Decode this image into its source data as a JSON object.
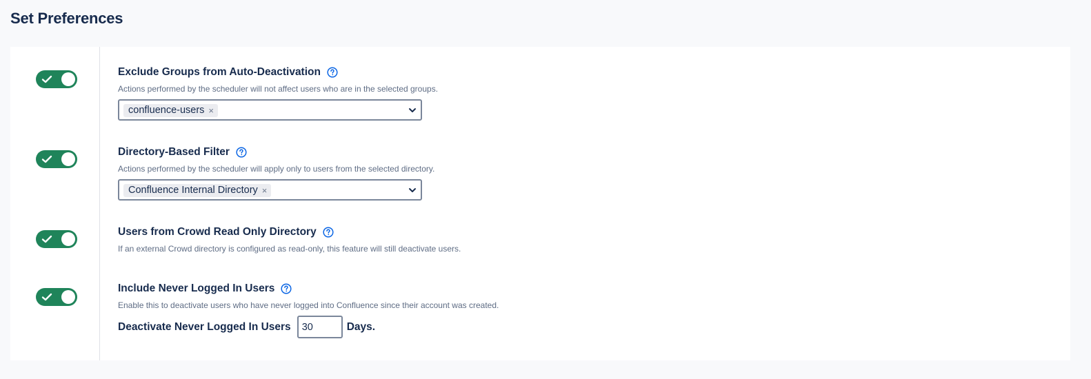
{
  "page": {
    "title": "Set Preferences"
  },
  "preferences": [
    {
      "title": "Exclude Groups from Auto-Deactivation",
      "description": "Actions performed by the scheduler will not affect users who are in the selected groups.",
      "enabled": true,
      "selected_tag": "confluence-users",
      "remove_symbol": "×"
    },
    {
      "title": "Directory-Based Filter",
      "description": "Actions performed by the scheduler will apply only to users from the selected directory.",
      "enabled": true,
      "selected_tag": "Confluence Internal Directory",
      "remove_symbol": "×"
    },
    {
      "title": "Users from Crowd Read Only Directory",
      "description": "If an external Crowd directory is configured as read-only, this feature will still deactivate users.",
      "enabled": true
    },
    {
      "title": "Include Never Logged In Users",
      "description": "Enable this to deactivate users who have never logged into Confluence since their account was created.",
      "enabled": true,
      "field_label": "Deactivate Never Logged In Users",
      "field_value": "30",
      "field_suffix": "Days."
    }
  ],
  "icons": {
    "toggle_check": "check-icon",
    "help": "help-icon",
    "dropdown": "chevron-down-icon"
  },
  "colors": {
    "toggle_on": "#1f845a",
    "help_blue": "#0c66e4",
    "title": "#172b4d",
    "description": "#5e6c84"
  }
}
